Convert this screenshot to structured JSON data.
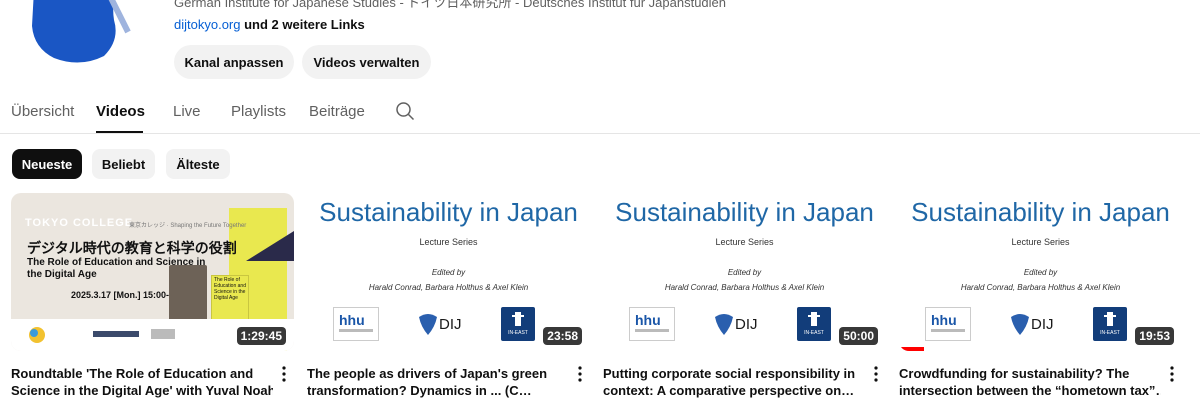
{
  "channel": {
    "subtitle": "German Institute for Japanese Studies - ドイツ日本研究所 - Deutsches Institut für Japanstudien",
    "links_primary": "dijtokyo.org",
    "links_more": "und 2 weitere Links"
  },
  "actions": {
    "customize": "Kanal anpassen",
    "manage": "Videos verwalten"
  },
  "tabs": [
    "Übersicht",
    "Videos",
    "Live",
    "Playlists",
    "Beiträge"
  ],
  "chips": [
    "Neueste",
    "Beliebt",
    "Älteste"
  ],
  "videos": [
    {
      "kind": "tokyo-college",
      "duration": "1:29:45",
      "title_line1": "Roundtable 'The Role of Education and",
      "title_line2": "Science in the Digital Age' with Yuval Noah…",
      "thumb": {
        "head": "TOKYO COLLEGE",
        "head_sub": "東京カレッジ · Shaping the Future Together",
        "jp": "デジタル時代の教育と科学の役割",
        "en1": "The Role of Education and Science in",
        "en2": "the Digital Age",
        "date": "2025.3.17 [Mon.] 15:00-16:30",
        "book": "The Role of Education and Science in the Digital Age"
      }
    },
    {
      "kind": "sustainability",
      "duration": "23:58",
      "title_line1": "The people as drivers of Japan's green",
      "title_line2": "transformation? Dynamics in ... (C…",
      "progress": 0
    },
    {
      "kind": "sustainability",
      "duration": "50:00",
      "title_line1": "Putting corporate social responsibility in",
      "title_line2": "context: A comparative perspective on…",
      "progress": 0
    },
    {
      "kind": "sustainability",
      "duration": "19:53",
      "title_line1": "Crowdfunding for sustainability? The",
      "title_line2": "intersection between the “hometown tax”…",
      "progress": 0.09
    }
  ],
  "sust": {
    "title": "Sustainability in Japan",
    "sub": "Lecture Series",
    "edited": "Edited by",
    "names": "Harald Conrad, Barbara Holthus & Axel Klein",
    "hhu": "hhu",
    "dij": "DIJ",
    "ineast": "IN-EAST"
  },
  "colors": {
    "accent_blue": "#065fd4",
    "sust_blue": "#1f67a6",
    "progress_red": "#ff0000"
  }
}
